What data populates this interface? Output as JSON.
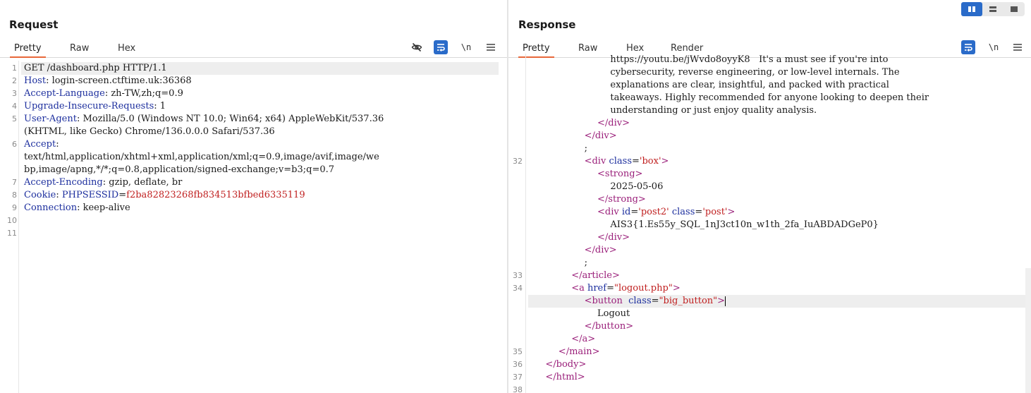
{
  "request": {
    "title": "Request",
    "tabs": [
      "Pretty",
      "Raw",
      "Hex"
    ],
    "active_tab": "Pretty",
    "tools": {
      "hide_icon": "eye-slash-icon",
      "wrap_icon": "wrap-lines-icon",
      "newline_label": "\\n",
      "menu_icon": "hamburger-menu-icon"
    },
    "lines": [
      {
        "n": "1",
        "parts": [
          [
            "GET /dashboard.php HTTP/1.1",
            "val"
          ]
        ]
      },
      {
        "n": "2",
        "parts": [
          [
            "Host",
            "k"
          ],
          [
            ": login-screen.ctftime.uk:36368",
            "val"
          ]
        ]
      },
      {
        "n": "3",
        "parts": [
          [
            "Accept-Language",
            "k"
          ],
          [
            ": zh-TW,zh;q=0.9",
            "val"
          ]
        ]
      },
      {
        "n": "4",
        "parts": [
          [
            "Upgrade-Insecure-Requests",
            "k"
          ],
          [
            ": 1",
            "val"
          ]
        ]
      },
      {
        "n": "5",
        "parts": [
          [
            "User-Agent",
            "k"
          ],
          [
            ": Mozilla/5.0 (Windows NT 10.0; Win64; x64) AppleWebKit/537.36",
            "val"
          ]
        ]
      },
      {
        "n": "",
        "parts": [
          [
            "(KHTML, like Gecko) Chrome/136.0.0.0 Safari/537.36",
            "val"
          ]
        ]
      },
      {
        "n": "6",
        "parts": [
          [
            "Accept",
            "k"
          ],
          [
            ":",
            "val"
          ]
        ]
      },
      {
        "n": "",
        "parts": [
          [
            "text/html,application/xhtml+xml,application/xml;q=0.9,image/avif,image/we",
            "val"
          ]
        ]
      },
      {
        "n": "",
        "parts": [
          [
            "bp,image/apng,*/*;q=0.8,application/signed-exchange;v=b3;q=0.7",
            "val"
          ]
        ]
      },
      {
        "n": "7",
        "parts": [
          [
            "Accept-Encoding",
            "k"
          ],
          [
            ": gzip, deflate, br",
            "val"
          ]
        ]
      },
      {
        "n": "8",
        "parts": [
          [
            "Cookie",
            "k"
          ],
          [
            ": ",
            "val"
          ],
          [
            "PHPSESSID",
            "k"
          ],
          [
            "=",
            "val"
          ],
          [
            "f2ba82823268fb834513bfbed6335119",
            "red"
          ]
        ]
      },
      {
        "n": "9",
        "parts": [
          [
            "Connection",
            "k"
          ],
          [
            ": keep-alive",
            "val"
          ]
        ]
      },
      {
        "n": "10",
        "parts": []
      },
      {
        "n": "11",
        "parts": []
      }
    ]
  },
  "response": {
    "title": "Response",
    "tabs": [
      "Pretty",
      "Raw",
      "Hex",
      "Render"
    ],
    "active_tab": "Pretty",
    "tools": {
      "wrap_icon": "wrap-lines-icon",
      "newline_label": "\\n",
      "menu_icon": "hamburger-menu-icon"
    },
    "layout_switch": [
      "split-horizontal-icon",
      "split-vertical-icon",
      "single-pane-icon"
    ],
    "lines": [
      {
        "n": "",
        "indent": 12,
        "parts": [
          [
            "https://youtu.be/jWvdo8oyyK8   It's a must see if you're into",
            "txt"
          ]
        ]
      },
      {
        "n": "",
        "indent": 12,
        "parts": [
          [
            "cybersecurity, reverse engineering, or low-level internals. The",
            "txt"
          ]
        ]
      },
      {
        "n": "",
        "indent": 12,
        "parts": [
          [
            "explanations are clear, insightful, and packed with practical",
            "txt"
          ]
        ]
      },
      {
        "n": "",
        "indent": 12,
        "parts": [
          [
            "takeaways. Highly recommended for anyone looking to deepen their",
            "txt"
          ]
        ]
      },
      {
        "n": "",
        "indent": 12,
        "parts": [
          [
            "understanding or just enjoy quality analysis.",
            "txt"
          ]
        ]
      },
      {
        "n": "",
        "indent": 10,
        "parts": [
          [
            "</div>",
            "tag"
          ]
        ]
      },
      {
        "n": "",
        "indent": 8,
        "parts": [
          [
            "</div>",
            "tag"
          ]
        ]
      },
      {
        "n": "",
        "indent": 8,
        "parts": [
          [
            ";",
            "txt"
          ]
        ]
      },
      {
        "n": "32",
        "indent": 8,
        "parts": [
          [
            "<div ",
            "tag"
          ],
          [
            "class",
            "attr"
          ],
          [
            "=",
            "txt"
          ],
          [
            "'box'",
            "str"
          ],
          [
            ">",
            "tag"
          ]
        ]
      },
      {
        "n": "",
        "indent": 10,
        "parts": [
          [
            "<strong>",
            "tag"
          ]
        ]
      },
      {
        "n": "",
        "indent": 12,
        "parts": [
          [
            "2025-05-06",
            "txt"
          ]
        ]
      },
      {
        "n": "",
        "indent": 10,
        "parts": [
          [
            "</strong>",
            "tag"
          ]
        ]
      },
      {
        "n": "",
        "indent": 10,
        "parts": [
          [
            "<div ",
            "tag"
          ],
          [
            "id",
            "attr"
          ],
          [
            "=",
            "txt"
          ],
          [
            "'post2'",
            "str"
          ],
          [
            " ",
            "txt"
          ],
          [
            "class",
            "attr"
          ],
          [
            "=",
            "txt"
          ],
          [
            "'post'",
            "str"
          ],
          [
            ">",
            "tag"
          ]
        ]
      },
      {
        "n": "",
        "indent": 12,
        "parts": [
          [
            "AIS3{1.Es55y_SQL_1nJ3ct10n_w1th_2fa_IuABDADGeP0}",
            "txt"
          ]
        ]
      },
      {
        "n": "",
        "indent": 10,
        "parts": [
          [
            "</div>",
            "tag"
          ]
        ]
      },
      {
        "n": "",
        "indent": 8,
        "parts": [
          [
            "</div>",
            "tag"
          ]
        ]
      },
      {
        "n": "",
        "indent": 8,
        "parts": [
          [
            ";",
            "txt"
          ]
        ]
      },
      {
        "n": "33",
        "indent": 6,
        "parts": [
          [
            "</article>",
            "tag"
          ]
        ]
      },
      {
        "n": "34",
        "indent": 6,
        "parts": [
          [
            "<a ",
            "tag"
          ],
          [
            "href",
            "attr"
          ],
          [
            "=",
            "txt"
          ],
          [
            "\"logout.php\"",
            "str"
          ],
          [
            ">",
            "tag"
          ]
        ]
      },
      {
        "n": "",
        "indent": 8,
        "hl": true,
        "caret": true,
        "parts": [
          [
            "<button  ",
            "tag"
          ],
          [
            "class",
            "attr"
          ],
          [
            "=",
            "txt"
          ],
          [
            "\"big_button\"",
            "str"
          ],
          [
            ">",
            "tag"
          ]
        ]
      },
      {
        "n": "",
        "indent": 10,
        "parts": [
          [
            "Logout",
            "txt"
          ]
        ]
      },
      {
        "n": "",
        "indent": 8,
        "parts": [
          [
            "</button>",
            "tag"
          ]
        ]
      },
      {
        "n": "",
        "indent": 6,
        "parts": [
          [
            "</a>",
            "tag"
          ]
        ]
      },
      {
        "n": "35",
        "indent": 4,
        "parts": [
          [
            "</main>",
            "tag"
          ]
        ]
      },
      {
        "n": "36",
        "indent": 2,
        "parts": [
          [
            "</body>",
            "tag"
          ]
        ]
      },
      {
        "n": "37",
        "indent": 2,
        "parts": [
          [
            "</html>",
            "tag"
          ]
        ]
      },
      {
        "n": "38",
        "indent": 0,
        "parts": []
      }
    ]
  }
}
